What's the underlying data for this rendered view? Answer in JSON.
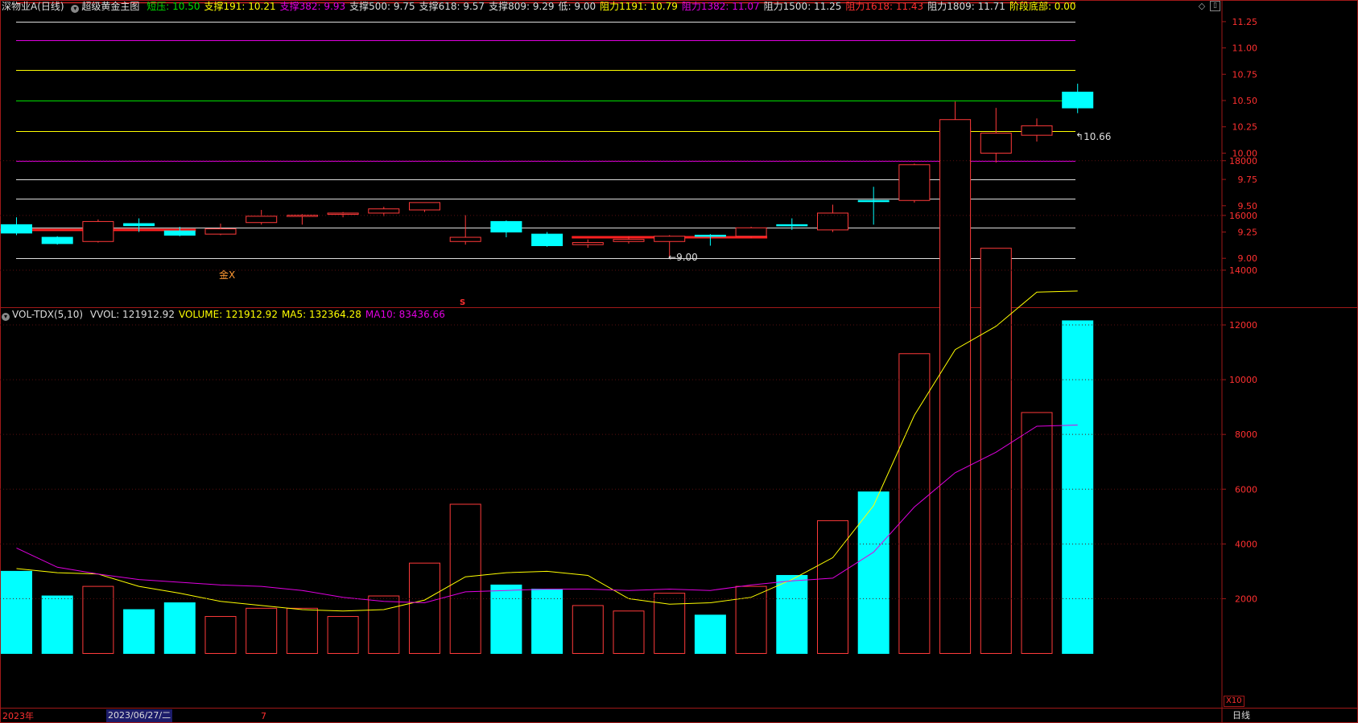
{
  "header": {
    "stock_name": "深物业A",
    "period": "(日线)",
    "indicator_name": "超级黄金主图",
    "items": [
      {
        "label": "短压:",
        "value": "10.50",
        "color": "#00e000"
      },
      {
        "label": "支撑191:",
        "value": "10.21",
        "color": "#ffff00"
      },
      {
        "label": "支撑382:",
        "value": "9.93",
        "color": "#e000e0"
      },
      {
        "label": "支撑500:",
        "value": "9.75",
        "color": "#dddddd"
      },
      {
        "label": "支撑618:",
        "value": "9.57",
        "color": "#dddddd"
      },
      {
        "label": "支撑809:",
        "value": "9.29",
        "color": "#dddddd"
      },
      {
        "label": "低:",
        "value": "9.00",
        "color": "#dddddd"
      },
      {
        "label": "阻力1191:",
        "value": "10.79",
        "color": "#ffff00"
      },
      {
        "label": "阻力1382:",
        "value": "11.07",
        "color": "#e000e0"
      },
      {
        "label": "阻力1500:",
        "value": "11.25",
        "color": "#dddddd"
      },
      {
        "label": "阻力1618:",
        "value": "11.43",
        "color": "#ff3030"
      },
      {
        "label": "阻力1809:",
        "value": "11.71",
        "color": "#dddddd"
      },
      {
        "label": "阶段底部:",
        "value": "0.00",
        "color": "#ffff00"
      }
    ]
  },
  "vol_header": {
    "name": "VOL-TDX(5,10)",
    "items": [
      {
        "label": "VVOL:",
        "value": "121912.92",
        "color": "#dddddd"
      },
      {
        "label": "VOLUME:",
        "value": "121912.92",
        "color": "#ffff00"
      },
      {
        "label": "MA5:",
        "value": "132364.28",
        "color": "#ffff00"
      },
      {
        "label": "MA10:",
        "value": "83436.66",
        "color": "#e000e0"
      }
    ]
  },
  "annotations": {
    "last_price": "10.66",
    "low_price": "9.00",
    "golden_cross": "金X",
    "s_marker": "S"
  },
  "footer": {
    "year": "2023年",
    "date_box": "2023/06/27/二",
    "month": "7",
    "period_btn": "日线",
    "x10": "X10"
  },
  "colors": {
    "up": "#ff3a3a",
    "down": "#00ffff",
    "ma5": "#ffff00",
    "ma10": "#e000e0",
    "axis": "#a01818"
  },
  "chart_data": [
    {
      "type": "candlestick",
      "title": "超级黄金主图",
      "ylim": [
        8.75,
        11.65
      ],
      "yticks": [
        "11.50",
        "11.25",
        "11.00",
        "10.75",
        "10.50",
        "10.25",
        "10.00",
        "9.75",
        "9.50",
        "9.25",
        "9.00"
      ],
      "levels": [
        {
          "value": 11.71,
          "color": "#dddddd"
        },
        {
          "value": 11.43,
          "color": "#ff3030"
        },
        {
          "value": 11.25,
          "color": "#dddddd"
        },
        {
          "value": 11.07,
          "color": "#e000e0"
        },
        {
          "value": 10.79,
          "color": "#ffff00"
        },
        {
          "value": 10.5,
          "color": "#00e000"
        },
        {
          "value": 10.21,
          "color": "#ffff00"
        },
        {
          "value": 9.93,
          "color": "#e000e0"
        },
        {
          "value": 9.75,
          "color": "#dddddd"
        },
        {
          "value": 9.57,
          "color": "#dddddd"
        },
        {
          "value": 9.29,
          "color": "#dddddd"
        },
        {
          "value": 9.0,
          "color": "#dddddd"
        }
      ],
      "candles": [
        {
          "o": 9.32,
          "h": 9.39,
          "c": 9.24,
          "l": 9.22
        },
        {
          "o": 9.2,
          "h": 9.21,
          "c": 9.14,
          "l": 9.13
        },
        {
          "o": 9.16,
          "h": 9.37,
          "c": 9.35,
          "l": 9.15
        },
        {
          "o": 9.33,
          "h": 9.38,
          "c": 9.31,
          "l": 9.25
        },
        {
          "o": 9.26,
          "h": 9.3,
          "c": 9.22,
          "l": 9.21
        },
        {
          "o": 9.23,
          "h": 9.33,
          "c": 9.28,
          "l": 9.22
        },
        {
          "o": 9.34,
          "h": 9.46,
          "c": 9.4,
          "l": 9.32
        },
        {
          "o": 9.41,
          "h": 9.42,
          "c": 9.41,
          "l": 9.32
        },
        {
          "o": 9.42,
          "h": 9.44,
          "c": 9.43,
          "l": 9.39
        },
        {
          "o": 9.43,
          "h": 9.49,
          "c": 9.47,
          "l": 9.4
        },
        {
          "o": 9.46,
          "h": 9.53,
          "c": 9.53,
          "l": 9.44
        },
        {
          "o": 9.16,
          "h": 9.41,
          "c": 9.2,
          "l": 9.13
        },
        {
          "o": 9.35,
          "h": 9.36,
          "c": 9.25,
          "l": 9.2
        },
        {
          "o": 9.23,
          "h": 9.25,
          "c": 9.12,
          "l": 9.11
        },
        {
          "o": 9.13,
          "h": 9.18,
          "c": 9.15,
          "l": 9.1
        },
        {
          "o": 9.16,
          "h": 9.21,
          "c": 9.18,
          "l": 9.14
        },
        {
          "o": 9.16,
          "h": 9.22,
          "c": 9.21,
          "l": 9.0
        },
        {
          "o": 9.22,
          "h": 9.23,
          "c": 9.21,
          "l": 9.12
        },
        {
          "o": 9.21,
          "h": 9.3,
          "c": 9.29,
          "l": 9.19
        },
        {
          "o": 9.32,
          "h": 9.38,
          "c": 9.31,
          "l": 9.27
        },
        {
          "o": 9.27,
          "h": 9.51,
          "c": 9.43,
          "l": 9.25
        },
        {
          "o": 9.55,
          "h": 9.68,
          "c": 9.54,
          "l": 9.32
        },
        {
          "o": 9.55,
          "h": 9.9,
          "c": 9.89,
          "l": 9.53
        },
        {
          "o": 9.9,
          "h": 10.49,
          "c": 10.24,
          "l": 9.83
        },
        {
          "o": 10.0,
          "h": 10.43,
          "c": 10.19,
          "l": 9.91
        },
        {
          "o": 10.17,
          "h": 10.33,
          "c": 10.26,
          "l": 10.11
        },
        {
          "o": 10.58,
          "h": 10.66,
          "c": 10.43,
          "l": 10.38
        }
      ],
      "red_level_segments": [
        {
          "from": 0,
          "to": 4,
          "value": 9.27
        },
        {
          "from": 14,
          "to": 18,
          "value": 9.2
        }
      ]
    },
    {
      "type": "bar",
      "title": "VOL-TDX(5,10)",
      "ylim": [
        0,
        19800
      ],
      "yticks": [
        "18000",
        "16000",
        "14000",
        "12000",
        "10000",
        "8000",
        "6000",
        "4000",
        "2000"
      ],
      "values": [
        3000,
        2100,
        2450,
        1600,
        1850,
        1350,
        1650,
        1650,
        1350,
        2100,
        3300,
        5450,
        2500,
        2350,
        1750,
        1550,
        2200,
        1400,
        2450,
        2850,
        4850,
        5900,
        10950,
        19500,
        14800,
        8800,
        12150
      ],
      "direction": [
        "down",
        "down",
        "up",
        "down",
        "down",
        "up",
        "up",
        "up",
        "up",
        "up",
        "up",
        "up",
        "down",
        "down",
        "up",
        "up",
        "up",
        "down",
        "up",
        "down",
        "up",
        "down",
        "up",
        "up",
        "up",
        "up",
        "down"
      ],
      "series": [
        {
          "name": "MA5",
          "values": [
            3100,
            2950,
            2900,
            2450,
            2200,
            1900,
            1750,
            1600,
            1550,
            1600,
            1950,
            2800,
            2950,
            3000,
            2850,
            2000,
            1800,
            1850,
            2050,
            2700,
            3500,
            5400,
            8700,
            11100,
            11950,
            13200,
            13236
          ]
        },
        {
          "name": "MA10",
          "values": [
            3850,
            3150,
            2900,
            2700,
            2600,
            2500,
            2450,
            2300,
            2050,
            1900,
            1850,
            2250,
            2300,
            2350,
            2350,
            2300,
            2350,
            2300,
            2500,
            2650,
            2750,
            3700,
            5350,
            6600,
            7350,
            8300,
            8344
          ]
        }
      ]
    }
  ]
}
